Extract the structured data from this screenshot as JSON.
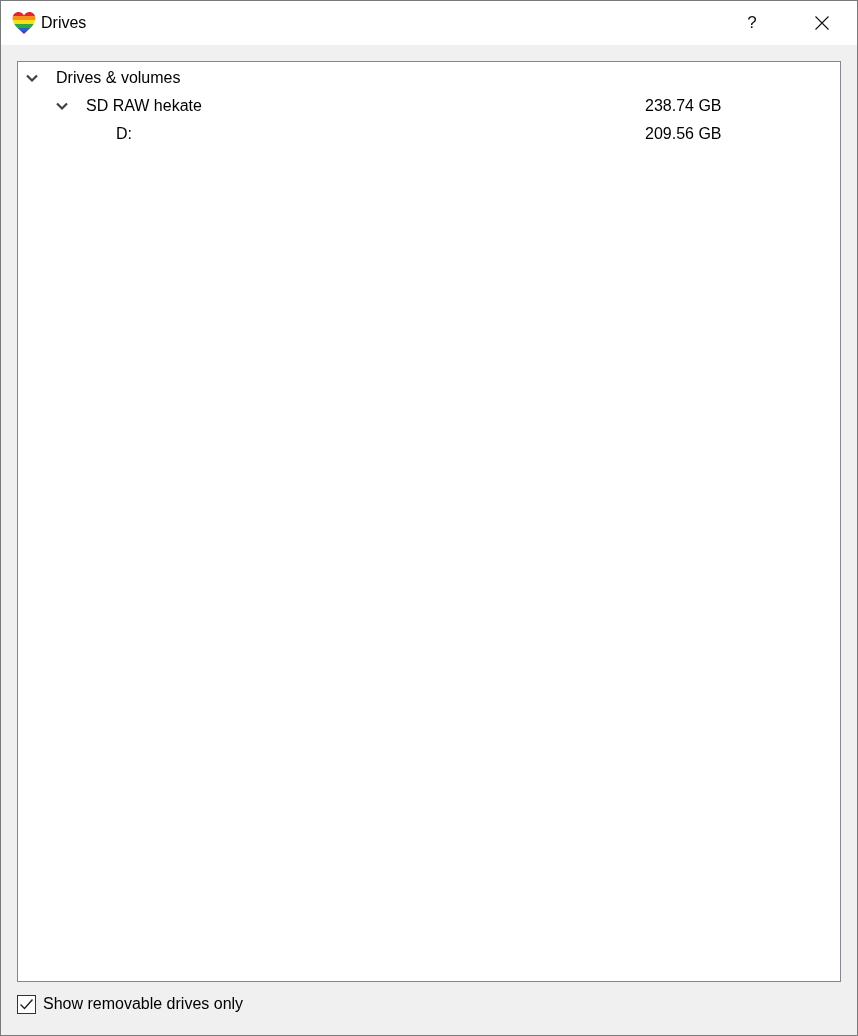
{
  "window": {
    "title": "Drives",
    "help": "?"
  },
  "tree": {
    "items": [
      {
        "label": "Drives & volumes",
        "expanded": true,
        "children": [
          {
            "label": "SD RAW hekate",
            "size": "238.74 GB",
            "expanded": true,
            "children": [
              {
                "label": "D:",
                "size": "209.56 GB"
              }
            ]
          }
        ]
      }
    ]
  },
  "footer": {
    "checkbox": {
      "label": "Show removable drives only",
      "checked": true
    }
  }
}
